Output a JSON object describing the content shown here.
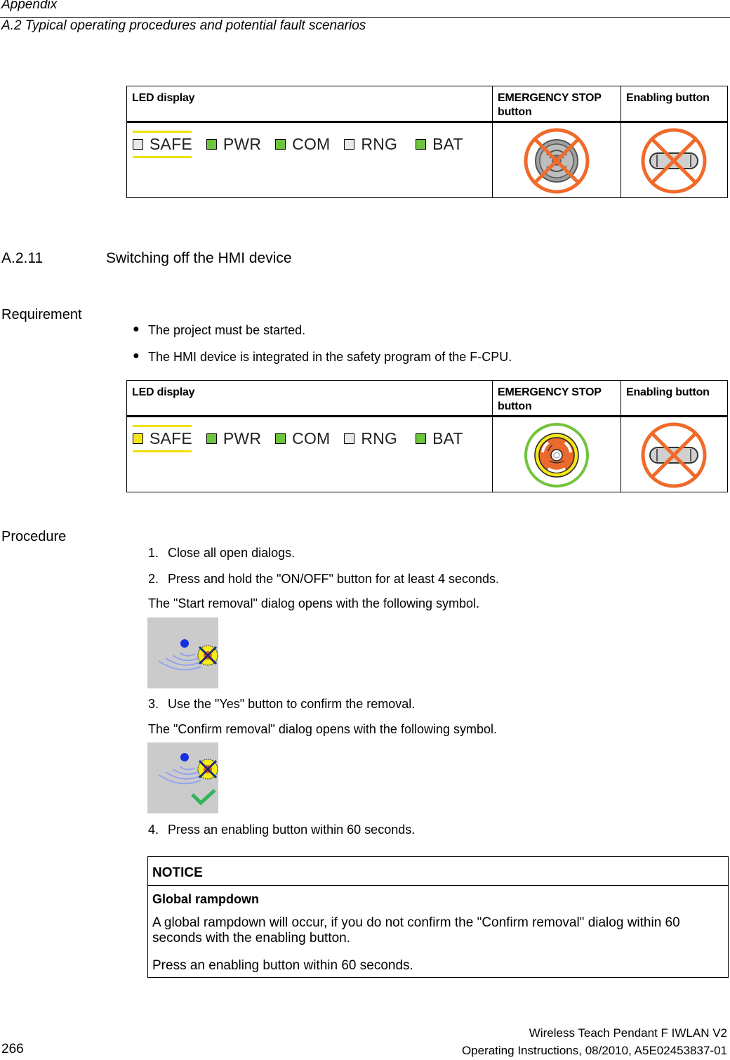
{
  "header": {
    "chapter": "Appendix",
    "section": "A.2 Typical operating procedures and potential fault scenarios"
  },
  "colors": {
    "led_green": "#6cc53a",
    "led_off": "#e8e8e8",
    "led_yellow": "#f3e61a",
    "safe_marker": "#f0e000",
    "cross_orange": "#f06a2a",
    "ok_green": "#72c43b",
    "symbol_bg": "#cbcbcb"
  },
  "table1": {
    "headers": {
      "led": "LED display",
      "stop": "EMERGENCY STOP button",
      "enable": "Enabling button"
    },
    "leds": [
      {
        "label": "SAFE",
        "state": "off"
      },
      {
        "label": "PWR",
        "state": "green"
      },
      {
        "label": "COM",
        "state": "green"
      },
      {
        "label": "RNG",
        "state": "off"
      },
      {
        "label": "BAT",
        "state": "green"
      }
    ],
    "stop_icon": "emergency-stop-crossed",
    "enable_icon": "enabling-button-crossed"
  },
  "section": {
    "number": "A.2.11",
    "title": "Switching off the HMI device"
  },
  "requirement": {
    "heading": "Requirement",
    "bullets": [
      "The project must be started.",
      "The HMI device is integrated in the safety program of the F-CPU."
    ],
    "bullet_char": "●"
  },
  "table2": {
    "headers": {
      "led": "LED display",
      "stop": "EMERGENCY STOP button",
      "enable": "Enabling button"
    },
    "leds": [
      {
        "label": "SAFE",
        "state": "yellow"
      },
      {
        "label": "PWR",
        "state": "green"
      },
      {
        "label": "COM",
        "state": "green"
      },
      {
        "label": "RNG",
        "state": "off"
      },
      {
        "label": "BAT",
        "state": "green"
      }
    ],
    "stop_icon": "emergency-stop-ok",
    "enable_icon": "enabling-button-crossed"
  },
  "procedure": {
    "heading": "Procedure",
    "steps": [
      {
        "num": "1.",
        "text": "Close all open dialogs."
      },
      {
        "num": "2.",
        "text": "Press and hold the \"ON/OFF\" button for at least 4 seconds.",
        "result": "The \"Start removal\" dialog opens with the following symbol."
      },
      {
        "num": "3.",
        "text": "Use the \"Yes\" button to confirm the removal.",
        "result": "The \"Confirm removal\" dialog opens with the following symbol."
      },
      {
        "num": "4.",
        "text": "Press an enabling button within 60 seconds."
      }
    ]
  },
  "notice": {
    "title": "NOTICE",
    "subtitle": "Global rampdown",
    "paragraph1": "A global rampdown will occur, if you do not confirm the \"Confirm removal\" dialog within 60 seconds with the enabling button.",
    "paragraph2": "Press an enabling button within 60 seconds."
  },
  "footer": {
    "page_number": "266",
    "product": "Wireless Teach Pendant F IWLAN V2",
    "document": "Operating Instructions, 08/2010, A5E02453837-01"
  }
}
